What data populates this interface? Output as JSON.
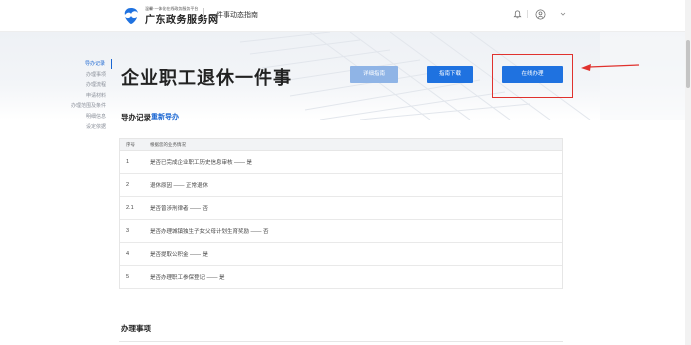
{
  "header": {
    "brand_small": "温馨·一体化在线政务服务平台",
    "brand_name": "广东政务服务网",
    "subtitle": "一件事动态指南",
    "icons": [
      "logo-icon",
      "bell-icon",
      "user-icon",
      "chevron-down-icon"
    ]
  },
  "side_nav": {
    "items": [
      {
        "label": "导办记录",
        "active": true
      },
      {
        "label": "办理事项",
        "active": false
      },
      {
        "label": "办理流程",
        "active": false
      },
      {
        "label": "申请材料",
        "active": false
      },
      {
        "label": "办理范围及条件",
        "active": false
      },
      {
        "label": "明细信息",
        "active": false
      },
      {
        "label": "设定依据",
        "active": false
      }
    ]
  },
  "page": {
    "title": "企业职工退休一件事"
  },
  "buttons": {
    "guide": "详细指南",
    "download": "指南下载",
    "online": "在线办理"
  },
  "section": {
    "title": "导办记录",
    "link": "重新导办"
  },
  "table": {
    "headers": [
      "序号",
      "根据您的业务情况"
    ],
    "rows": [
      {
        "no": "1",
        "text": "是否已完成企业职工历史信息审核 —— 是"
      },
      {
        "no": "2",
        "text": "退休原因 —— 正常退休"
      },
      {
        "no": "2.1",
        "text": "是否曾涉刑律者 —— 否"
      },
      {
        "no": "3",
        "text": "是否办理城镇独生子女父母计划生育奖励 —— 否"
      },
      {
        "no": "4",
        "text": "是否提取公积金 —— 是"
      },
      {
        "no": "5",
        "text": "是否办理职工参保登记 —— 是"
      }
    ]
  },
  "section2": {
    "title": "办理事项"
  },
  "colors": {
    "primary": "#1f72e0",
    "secondary_button": "#8fb4e6",
    "highlight": "#e0322e",
    "active_nav": "#1a66d2"
  }
}
